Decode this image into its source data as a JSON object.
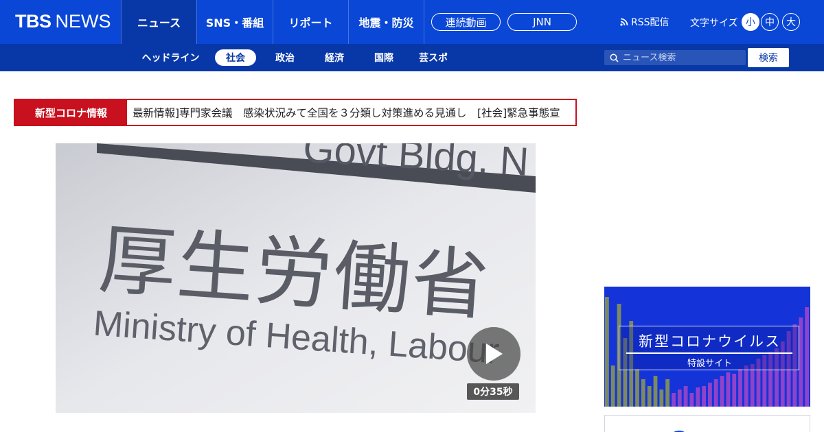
{
  "brand": {
    "logo_main": "TBS",
    "logo_sub": "NEWS"
  },
  "main_nav": [
    {
      "label": "ニュース",
      "active": true
    },
    {
      "label": "SNS・番組",
      "active": false
    },
    {
      "label": "リポート",
      "active": false
    },
    {
      "label": "地震・防災",
      "active": false
    }
  ],
  "header_pills": [
    {
      "label": "連続動画"
    },
    {
      "label": "JNN"
    }
  ],
  "rss": {
    "label": "RSS配信",
    "icon": "rss-icon"
  },
  "font_size": {
    "label": "文字サイズ",
    "options": [
      "小",
      "中",
      "大"
    ],
    "selected": "小"
  },
  "sub_nav": [
    {
      "label": "ヘッドライン",
      "active": false
    },
    {
      "label": "社会",
      "active": true
    },
    {
      "label": "政治",
      "active": false
    },
    {
      "label": "経済",
      "active": false
    },
    {
      "label": "国際",
      "active": false
    },
    {
      "label": "芸スポ",
      "active": false
    }
  ],
  "search": {
    "placeholder": "ニュース検索",
    "button_label": "検索",
    "icon": "search-icon"
  },
  "ticker": {
    "label": "新型コロナ情報",
    "text": "最新情報]専門家会議　感染状況みて全国を３分類し対策進める見通し　[社会]緊急事態宣"
  },
  "video": {
    "duration": "0分35秒",
    "sign_text_ja": "厚生労働省",
    "sign_text_en": "Ministry of Health, Labour",
    "sign_top_text": "Govt Bldg. N",
    "play_icon": "play-icon"
  },
  "article": {
    "headline_peek": ""
  },
  "banner": {
    "title": "新型コロナウイルス",
    "subtitle": "特設サイト"
  },
  "colors": {
    "brand_blue": "#0a47d6",
    "subnav_blue": "#0838a8",
    "ticker_red": "#c8101e"
  }
}
